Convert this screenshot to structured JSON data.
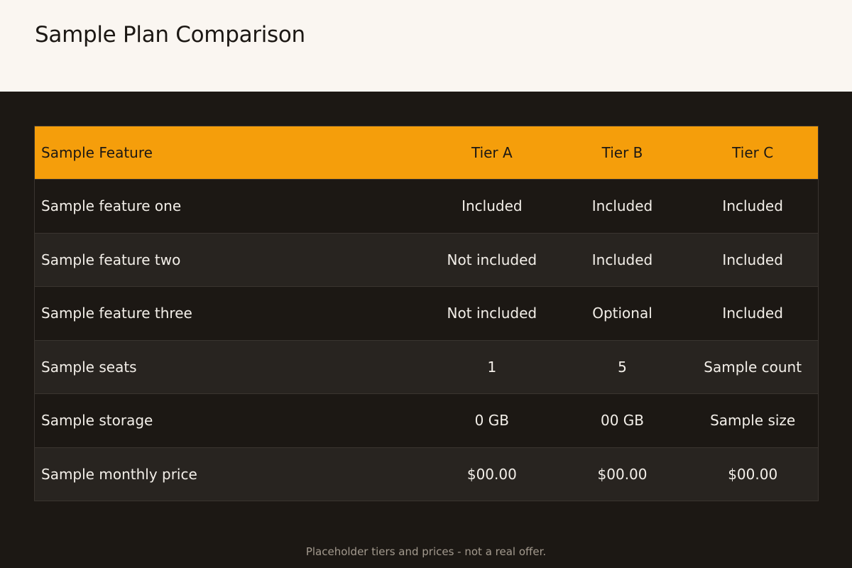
{
  "header": {
    "title": "Sample Plan Comparison"
  },
  "table": {
    "columns": [
      "Sample Feature",
      "Tier A",
      "Tier B",
      "Tier C"
    ],
    "rows": [
      [
        "Sample feature one",
        "Included",
        "Included",
        "Included"
      ],
      [
        "Sample feature two",
        "Not included",
        "Included",
        "Included"
      ],
      [
        "Sample feature three",
        "Not included",
        "Optional",
        "Included"
      ],
      [
        "Sample seats",
        "1",
        "5",
        "Sample count"
      ],
      [
        "Sample storage",
        "0 GB",
        "00 GB",
        "Sample size"
      ],
      [
        "Sample monthly price",
        "$00.00",
        "$00.00",
        "$00.00"
      ]
    ]
  },
  "footer": {
    "note": "Placeholder tiers and prices - not a real offer."
  },
  "colors": {
    "header_background": "#faf6f1",
    "page_background": "#1c1814",
    "accent": "#f59e0b",
    "row_alt": "#282420"
  }
}
